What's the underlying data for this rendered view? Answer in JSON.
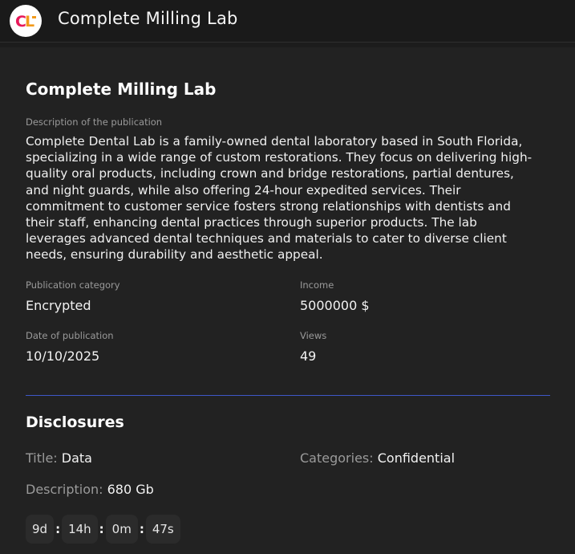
{
  "header": {
    "app_title": "Complete Milling Lab",
    "logo_text": "CL"
  },
  "publication": {
    "title": "Complete Milling Lab",
    "description_label": "Description of the publication",
    "description": "Complete Dental Lab is a family-owned dental laboratory based in South Florida, specializing in a wide range of custom restorations. They focus on delivering high-quality oral products, including crown and bridge restorations, partial dentures, and night guards, while also offering 24-hour expedited services. Their commitment to customer service fosters strong relationships with dentists and their staff, enhancing dental practices through superior products. The lab leverages advanced dental techniques and materials to cater to diverse client needs, ensuring durability and aesthetic appeal.",
    "category_label": "Publication category",
    "category": "Encrypted",
    "income_label": "Income",
    "income": "5000000 $",
    "date_label": "Date of publication",
    "date": "10/10/2025",
    "views_label": "Views",
    "views": "49"
  },
  "disclosures": {
    "heading": "Disclosures",
    "title_label": "Title:",
    "title_value": "Data",
    "categories_label": "Categories:",
    "categories_value": "Confidential",
    "description_label": "Description:",
    "description_value": "680 Gb"
  },
  "timer": {
    "days": "9d",
    "hours": "14h",
    "minutes": "0m",
    "seconds": "47s",
    "separator": ":"
  },
  "colors": {
    "background": "#1c1c1c",
    "card": "#222222",
    "divider": "#3f58c9",
    "logo_accent": "#e8195a"
  }
}
